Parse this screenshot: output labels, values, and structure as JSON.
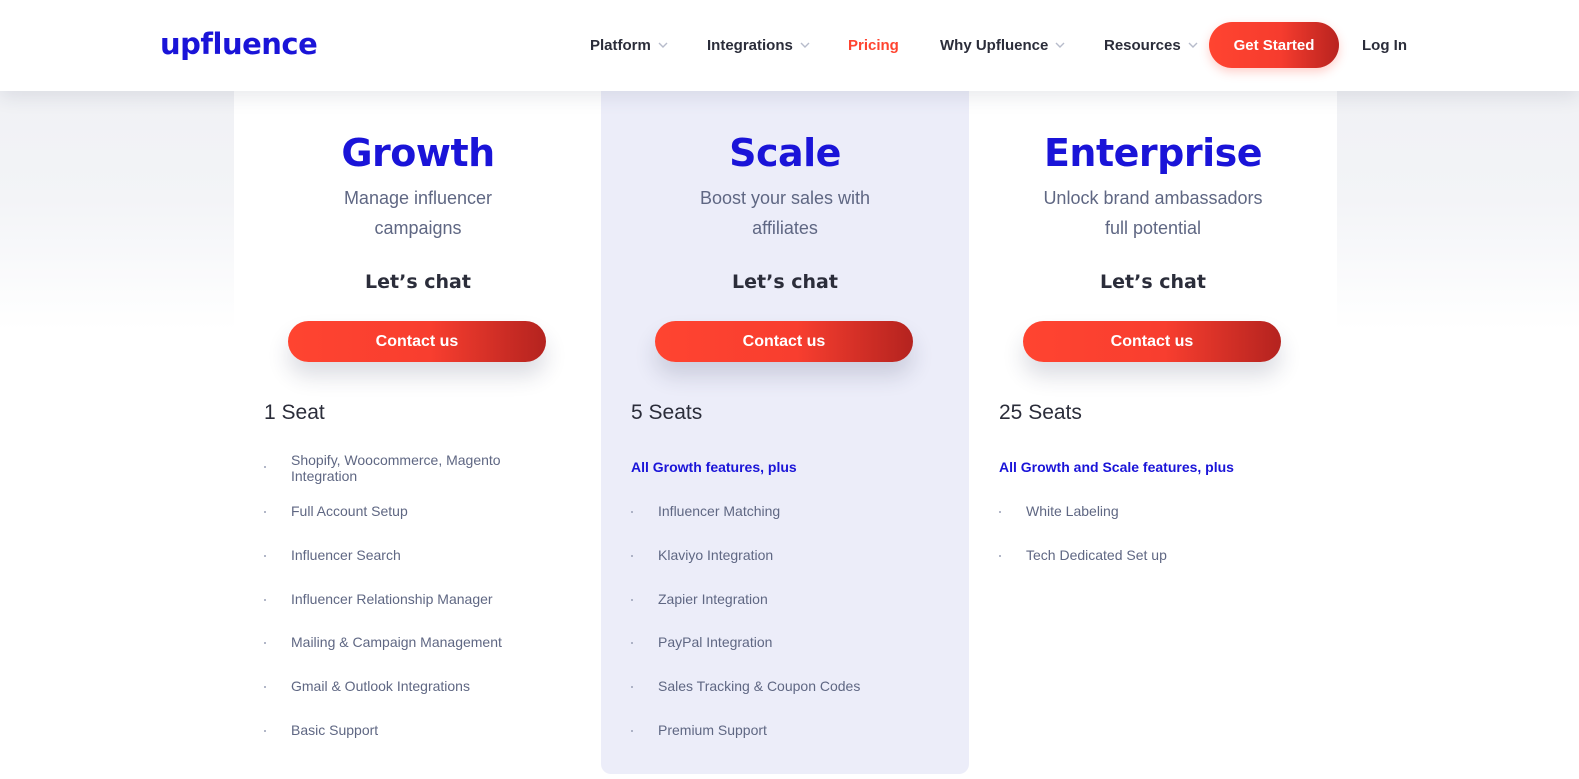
{
  "header": {
    "logo_text": "upfluence",
    "nav": [
      {
        "label": "Platform",
        "has_dropdown": true,
        "active": false
      },
      {
        "label": "Integrations",
        "has_dropdown": true,
        "active": false
      },
      {
        "label": "Pricing",
        "has_dropdown": false,
        "active": true
      },
      {
        "label": "Why Upfluence",
        "has_dropdown": true,
        "active": false
      },
      {
        "label": "Resources",
        "has_dropdown": true,
        "active": false
      }
    ],
    "cta_label": "Get Started",
    "login_label": "Log In"
  },
  "colors": {
    "brand_blue": "#1a14d8",
    "accent_red": "#ff4430",
    "text_dark": "#2b2d3a",
    "text_muted": "#5f6783",
    "scale_bg": "#ecedf9"
  },
  "plans": [
    {
      "name": "Growth",
      "subtitle_line1": "Manage influencer",
      "subtitle_line2": "campaigns",
      "price": "Let’s chat",
      "button_label": "Contact us",
      "seats": "1 Seat",
      "intro": "",
      "features": [
        "Shopify, Woocommerce, Magento Integration",
        "Full Account Setup",
        "Influencer Search",
        "Influencer Relationship Manager",
        "Mailing & Campaign Management",
        "Gmail & Outlook Integrations",
        "Basic Support"
      ]
    },
    {
      "name": "Scale",
      "subtitle_line1": "Boost your sales with",
      "subtitle_line2": "affiliates",
      "price": "Let’s chat",
      "button_label": "Contact us",
      "seats": "5 Seats",
      "intro": "All Growth features, plus",
      "features": [
        "Influencer Matching",
        "Klaviyo Integration",
        "Zapier Integration",
        "PayPal Integration",
        "Sales Tracking & Coupon Codes",
        "Premium Support"
      ]
    },
    {
      "name": "Enterprise",
      "subtitle_line1": "Unlock brand ambassadors",
      "subtitle_line2": "full potential",
      "price": "Let’s chat",
      "button_label": "Contact us",
      "seats": "25 Seats",
      "intro": "All Growth and Scale features, plus",
      "features": [
        "White Labeling",
        "Tech Dedicated Set up"
      ]
    }
  ]
}
